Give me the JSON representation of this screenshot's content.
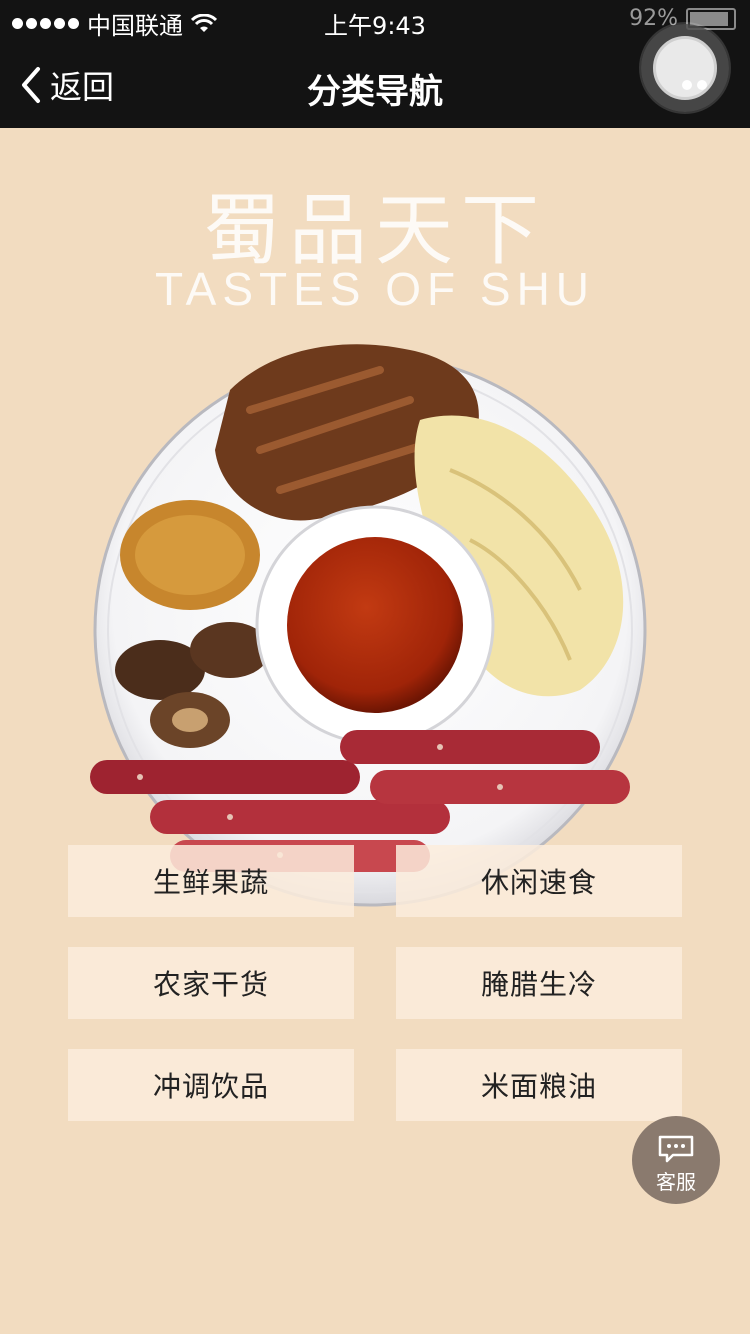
{
  "status_bar": {
    "carrier": "中国联通",
    "time": "上午9:43",
    "battery": "92%",
    "battery_level": 0.92
  },
  "nav": {
    "back_label": "返回",
    "title": "分类导航"
  },
  "banner": {
    "title_cn": "蜀品天下",
    "title_en": "TASTES OF SHU"
  },
  "categories": [
    {
      "label": "生鲜果蔬"
    },
    {
      "label": "休闲速食"
    },
    {
      "label": "农家干货"
    },
    {
      "label": "腌腊生冷"
    },
    {
      "label": "冲调饮品"
    },
    {
      "label": "米面粮油"
    }
  ],
  "customer_service": {
    "label": "客服",
    "icon": "chat-bubble-icon"
  },
  "icons": {
    "back": "chevron-left-icon",
    "wifi": "wifi-icon",
    "battery": "battery-icon",
    "float": "assistive-touch-icon"
  }
}
